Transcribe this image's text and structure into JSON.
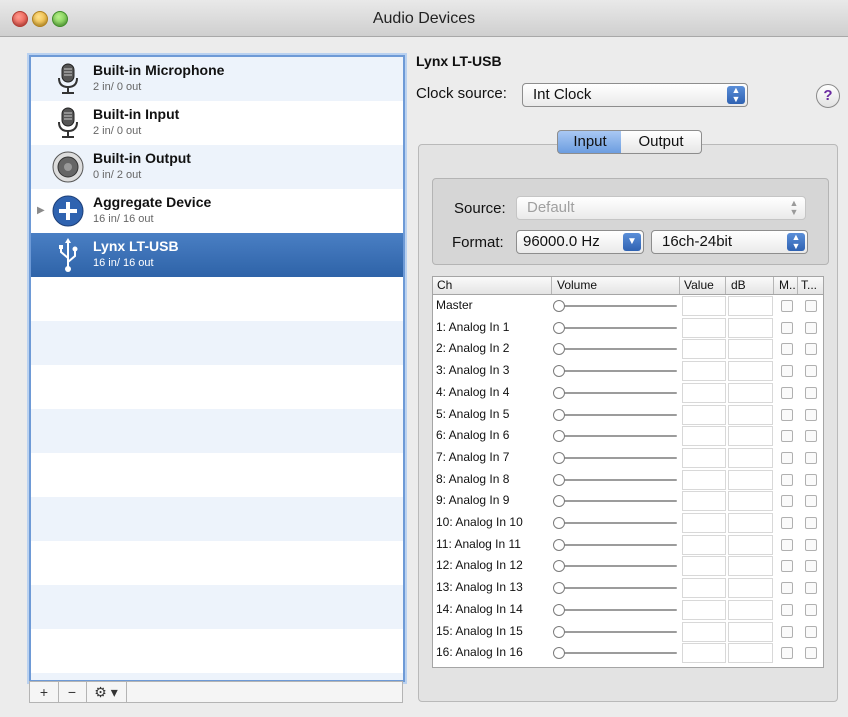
{
  "window": {
    "title": "Audio Devices"
  },
  "devices": [
    {
      "name": "Built-in Microphone",
      "io": "2 in/ 0 out",
      "icon": "microphone-icon"
    },
    {
      "name": "Built-in Input",
      "io": "2 in/ 0 out",
      "icon": "microphone-icon"
    },
    {
      "name": "Built-in Output",
      "io": "0 in/ 2 out",
      "icon": "speaker-icon"
    },
    {
      "name": "Aggregate Device",
      "io": "16 in/ 16 out",
      "icon": "plus-circle-icon"
    },
    {
      "name": "Lynx LT-USB",
      "io": "16 in/ 16 out",
      "icon": "usb-icon",
      "selected": true
    }
  ],
  "bottom_bar": {
    "add": "+",
    "remove": "−",
    "action": "⚙ ▾"
  },
  "detail": {
    "device_name": "Lynx LT-USB",
    "clock_source_label": "Clock source:",
    "clock_source_value": "Int Clock",
    "help": "?",
    "tabs": [
      "Input",
      "Output"
    ],
    "active_tab": "Input",
    "source_label": "Source:",
    "source_value": "Default",
    "format_label": "Format:",
    "format_rate": "96000.0 Hz",
    "format_bits": "16ch-24bit"
  },
  "table": {
    "headers": [
      "Ch",
      "Volume",
      "Value",
      "dB",
      "M..",
      "T..."
    ],
    "rows": [
      "Master",
      "1: Analog In 1",
      "2: Analog In 2",
      "3: Analog In 3",
      "4: Analog In 4",
      "5: Analog In 5",
      "6: Analog In 6",
      "7: Analog In 7",
      "8: Analog In 8",
      "9: Analog In 9",
      "10: Analog In 10",
      "11: Analog In 11",
      "12: Analog In 12",
      "13: Analog In 13",
      "14: Analog In 14",
      "15: Analog In 15",
      "16: Analog In 16"
    ]
  },
  "colors": {
    "selection": "#3a6fb5",
    "stripe": "#edf3fb",
    "accent": "#6c9de0"
  }
}
